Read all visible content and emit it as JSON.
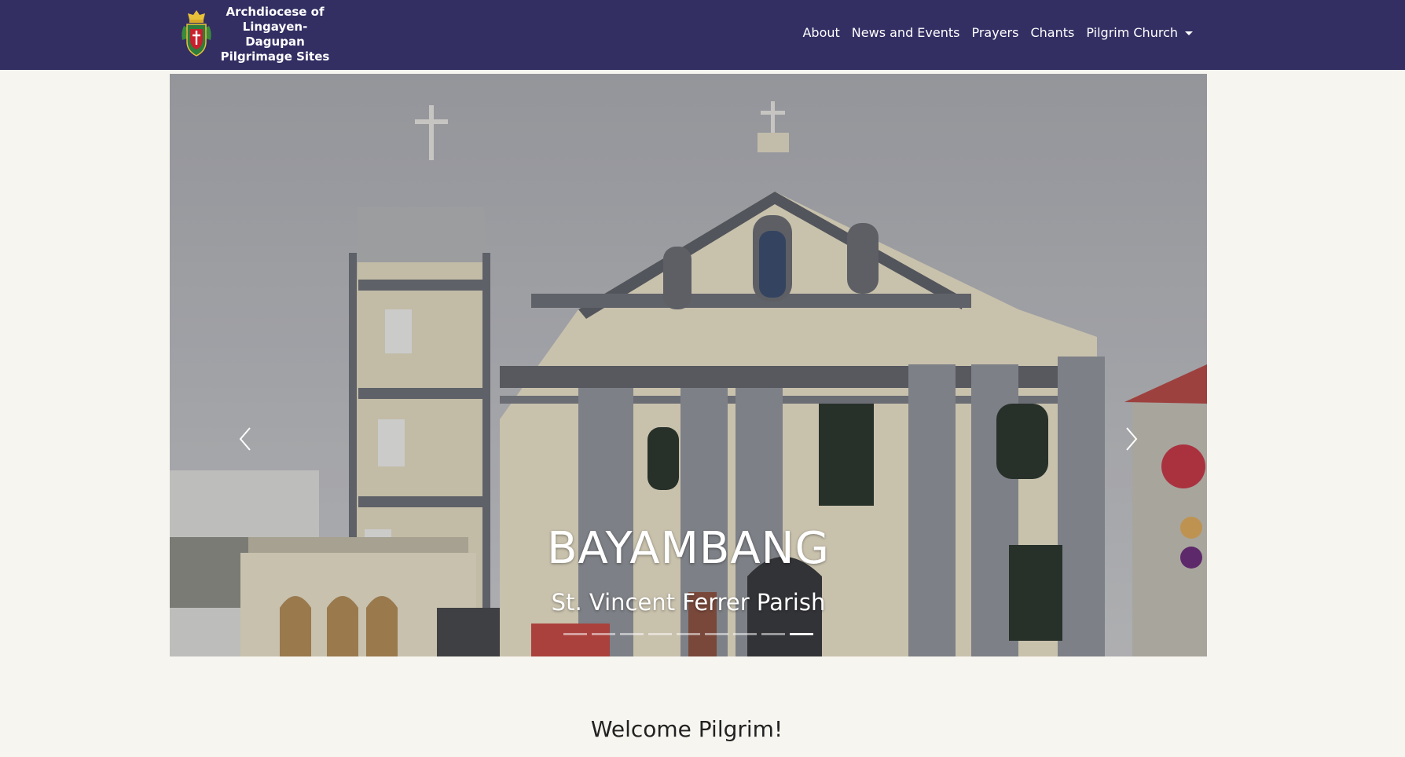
{
  "brand": {
    "line1": "Archdiocese of",
    "line2": "Lingayen-Dagupan",
    "line3": "Pilgrimage Sites",
    "logo_icon": "archdiocese-crest-icon"
  },
  "nav": {
    "items": [
      {
        "label": "About"
      },
      {
        "label": "News and Events"
      },
      {
        "label": "Prayers"
      },
      {
        "label": "Chants"
      },
      {
        "label": "Pilgrim Church",
        "dropdown": true
      }
    ]
  },
  "carousel": {
    "title": "BAYAMBANG",
    "subtitle": "St. Vincent Ferrer Parish",
    "prev_icon": "chevron-left-icon",
    "next_icon": "chevron-right-icon",
    "slide_count": 9,
    "active_slide": 9
  },
  "main": {
    "welcome": "Welcome Pilgrim!"
  },
  "colors": {
    "navbar": "#332f63",
    "page_background": "#f7f5ef",
    "text": "#222222"
  }
}
